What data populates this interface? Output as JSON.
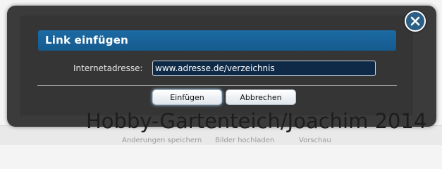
{
  "dialog": {
    "title": "Link einfügen",
    "field_label": "Internetadresse:",
    "url_value": "www.adresse.de/verzeichnis",
    "insert_label": "Einfügen",
    "cancel_label": "Abbrechen",
    "close_icon": "close-circle-icon"
  },
  "background_toolbar": {
    "save_label": "Änderungen speichern",
    "upload_label": "Bilder hochladen",
    "preview_label": "Vorschau"
  },
  "watermark": "Hobby-Gartenteich/Joachim 2014",
  "colors": {
    "title_bar": "#1c6aa4",
    "frame": "#3b3b3b",
    "input_bg": "#0f2a47"
  }
}
